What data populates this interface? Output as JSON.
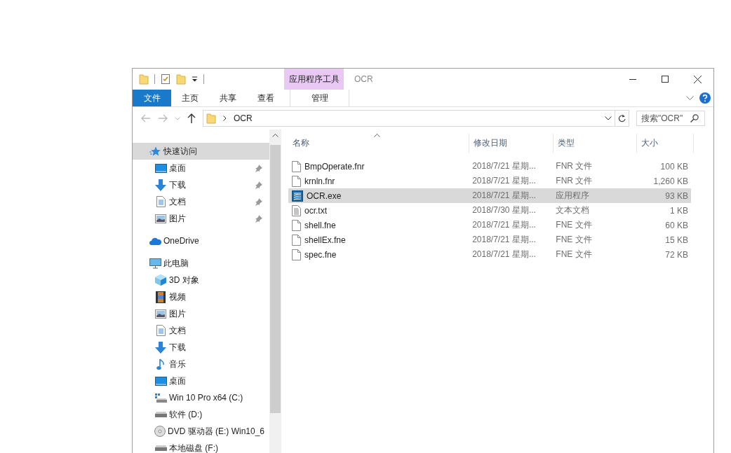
{
  "window": {
    "title": "OCR",
    "context_tab_group": "应用程序工具"
  },
  "ribbon_tabs": [
    {
      "label": "文件",
      "kind": "file",
      "selected": false
    },
    {
      "label": "主页",
      "kind": "tab",
      "selected": false
    },
    {
      "label": "共享",
      "kind": "tab",
      "selected": false
    },
    {
      "label": "查看",
      "kind": "tab",
      "selected": false
    },
    {
      "label": "管理",
      "kind": "context",
      "selected": false
    }
  ],
  "address": {
    "path": "OCR"
  },
  "search": {
    "placeholder": "搜索\"OCR\""
  },
  "sidebar": {
    "items": [
      {
        "label": "快速访问",
        "kind": "star",
        "selected": true,
        "children": [
          {
            "label": "桌面",
            "kind": "desktop",
            "pinned": true
          },
          {
            "label": "下载",
            "kind": "download",
            "pinned": true
          },
          {
            "label": "文档",
            "kind": "document",
            "pinned": true
          },
          {
            "label": "图片",
            "kind": "picture",
            "pinned": true
          }
        ]
      },
      {
        "label": "OneDrive",
        "kind": "cloud",
        "selected": false
      },
      {
        "label": "此电脑",
        "kind": "computer",
        "selected": false,
        "children": [
          {
            "label": "3D 对象",
            "kind": "cube"
          },
          {
            "label": "视频",
            "kind": "video"
          },
          {
            "label": "图片",
            "kind": "picture"
          },
          {
            "label": "文档",
            "kind": "document"
          },
          {
            "label": "下载",
            "kind": "download"
          },
          {
            "label": "音乐",
            "kind": "music"
          },
          {
            "label": "桌面",
            "kind": "desktop"
          },
          {
            "label": "Win 10 Pro x64 (C:)",
            "kind": "system-drive"
          },
          {
            "label": "软件 (D:)",
            "kind": "drive"
          },
          {
            "label": "DVD 驱动器 (E:) Win10_6",
            "kind": "dvd"
          },
          {
            "label": "本地磁盘 (F:)",
            "kind": "drive"
          }
        ]
      }
    ]
  },
  "table": {
    "columns": [
      "名称",
      "修改日期",
      "类型",
      "大小"
    ],
    "rows": [
      {
        "name": "BmpOperate.fnr",
        "date": "2018/7/21 星期...",
        "type": "FNR 文件",
        "size": "100 KB",
        "kind": "blank",
        "selected": false
      },
      {
        "name": "krnln.fnr",
        "date": "2018/7/21 星期...",
        "type": "FNR 文件",
        "size": "1,260 KB",
        "kind": "blank",
        "selected": false
      },
      {
        "name": "OCR.exe",
        "date": "2018/7/21 星期...",
        "type": "应用程序",
        "size": "93 KB",
        "kind": "app",
        "selected": true
      },
      {
        "name": "ocr.txt",
        "date": "2018/7/30 星期...",
        "type": "文本文档",
        "size": "1 KB",
        "kind": "text",
        "selected": false
      },
      {
        "name": "shell.fne",
        "date": "2018/7/21 星期...",
        "type": "FNE 文件",
        "size": "60 KB",
        "kind": "blank",
        "selected": false
      },
      {
        "name": "shellEx.fne",
        "date": "2018/7/21 星期...",
        "type": "FNE 文件",
        "size": "15 KB",
        "kind": "blank",
        "selected": false
      },
      {
        "name": "spec.fne",
        "date": "2018/7/21 星期...",
        "type": "FNE 文件",
        "size": "72 KB",
        "kind": "blank",
        "selected": false
      }
    ]
  }
}
